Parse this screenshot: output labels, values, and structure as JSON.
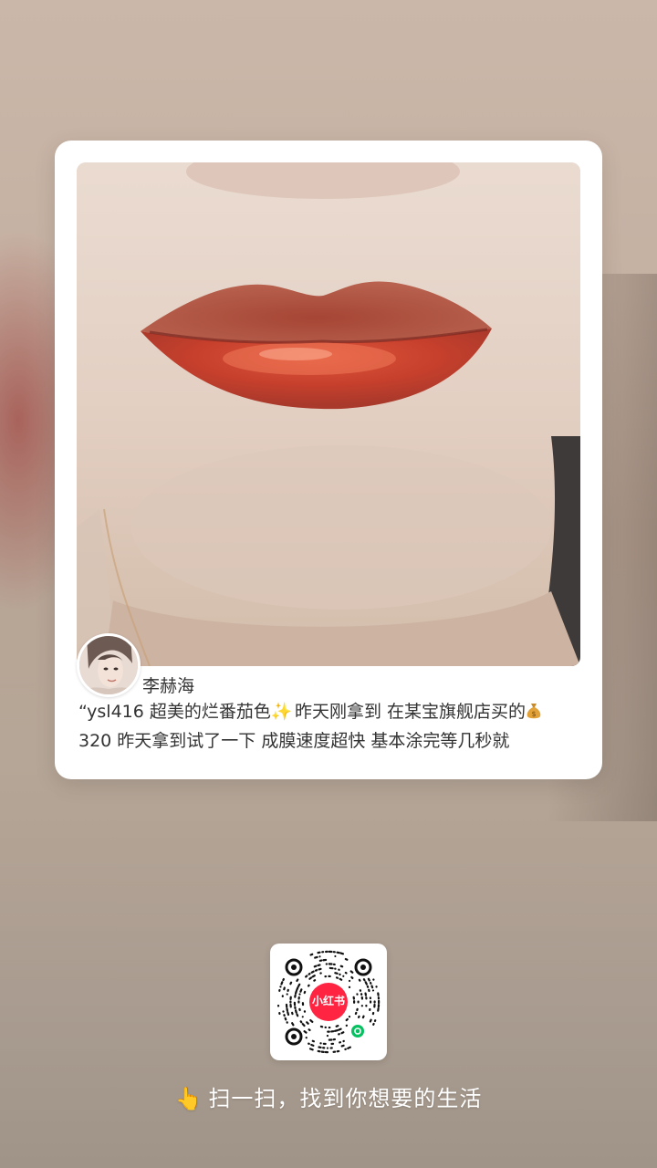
{
  "card": {
    "author_name": "李赫海",
    "caption_line1_a": "“ysl416 超美的烂番茄色",
    "caption_line1_b": " 昨天刚拿到 在某宝旗舰店买的",
    "caption_line2": "320 昨天拿到试了一下 成膜速度超快 基本涂完等几秒就",
    "sparkle_icon": "✨",
    "money_icon": "money-bag"
  },
  "qr": {
    "badge_label": "小红书",
    "badge_color": "#ff2442",
    "mini_program_color": "#07c160"
  },
  "footer": {
    "hand_icon": "👆",
    "scan_text": "扫一扫，找到你想要的生活"
  }
}
